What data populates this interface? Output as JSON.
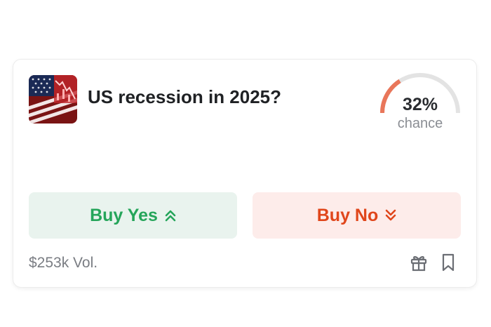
{
  "market": {
    "title": "US recession in 2025?",
    "chance_value": "32%",
    "chance_fraction": 0.32,
    "chance_label": "chance",
    "volume": "$253k Vol."
  },
  "buttons": {
    "yes_label": "Buy Yes",
    "no_label": "Buy No"
  },
  "icons": {
    "thumbnail": "us-flag-chart-image",
    "yes_chevron": "double-chevron-up-icon",
    "no_chevron": "double-chevron-down-icon",
    "gift": "gift-icon",
    "bookmark": "bookmark-icon"
  },
  "colors": {
    "yes": "#25a55a",
    "yes_bg": "#e9f3ee",
    "no": "#e0461b",
    "no_bg": "#fdecea",
    "gauge_fill": "#e9765a",
    "gauge_track": "#e3e3e3"
  }
}
